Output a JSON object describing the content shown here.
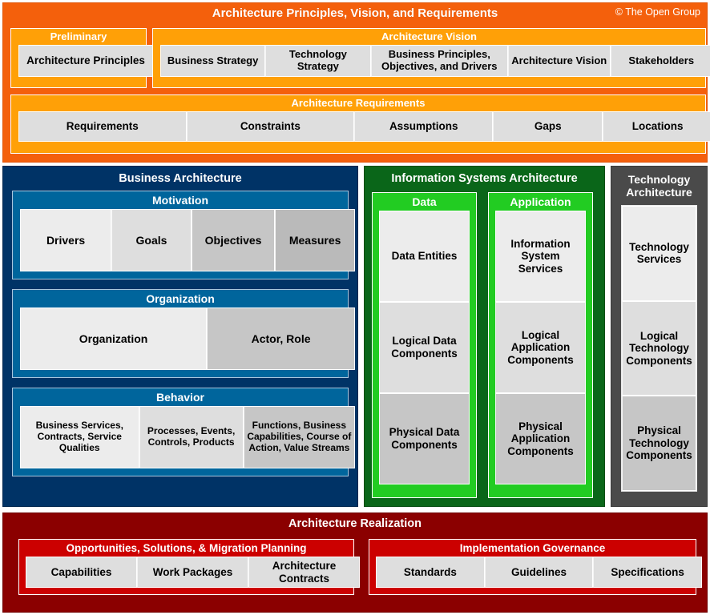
{
  "colors": {
    "orange_outer": "#f4600c",
    "orange_inner": "#ffa007",
    "blue_outer": "#003366",
    "blue_inner": "#00659c",
    "green_outer": "#0a6619",
    "green_inner": "#22cc22",
    "gray": "#4a4a4a",
    "red_outer": "#8b0000",
    "red_inner": "#cc0000",
    "cell_light": "#ececec",
    "cell_dark": "#bababa"
  },
  "top": {
    "title": "Architecture Principles, Vision, and Requirements",
    "copyright": "© The Open Group",
    "preliminary": {
      "title": "Preliminary",
      "cells": [
        "Architecture Principles"
      ]
    },
    "architecture_vision": {
      "title": "Architecture Vision",
      "cells": [
        "Business Strategy",
        "Technology Strategy",
        "Business Principles, Objectives, and Drivers",
        "Architecture Vision",
        "Stakeholders"
      ]
    },
    "architecture_requirements": {
      "title": "Architecture Requirements",
      "cells": [
        "Requirements",
        "Constraints",
        "Assumptions",
        "Gaps",
        "Locations"
      ]
    }
  },
  "business": {
    "title": "Business Architecture",
    "panels": [
      {
        "title": "Motivation",
        "cells": [
          "Drivers",
          "Goals",
          "Objectives",
          "Measures"
        ]
      },
      {
        "title": "Organization",
        "cells": [
          "Organization",
          "Actor, Role"
        ]
      },
      {
        "title": "Behavior",
        "cells": [
          "Business Services, Contracts, Service Qualities",
          "Processes, Events, Controls, Products",
          "Functions, Business Capabilities, Course of Action, Value Streams"
        ]
      }
    ]
  },
  "information_systems": {
    "title": "Information Systems Architecture",
    "panels": [
      {
        "title": "Data",
        "cells": [
          "Data Entities",
          "Logical Data Components",
          "Physical Data Components"
        ]
      },
      {
        "title": "Application",
        "cells": [
          "Information System Services",
          "Logical Application Components",
          "Physical Application Components"
        ]
      }
    ]
  },
  "technology": {
    "title": "Technology Architecture",
    "cells": [
      "Technology Services",
      "Logical Technology Components",
      "Physical Technology Components"
    ]
  },
  "realization": {
    "title": "Architecture Realization",
    "panels": [
      {
        "title": "Opportunities, Solutions, & Migration Planning",
        "cells": [
          "Capabilities",
          "Work Packages",
          "Architecture Contracts"
        ]
      },
      {
        "title": "Implementation Governance",
        "cells": [
          "Standards",
          "Guidelines",
          "Specifications"
        ]
      }
    ]
  }
}
